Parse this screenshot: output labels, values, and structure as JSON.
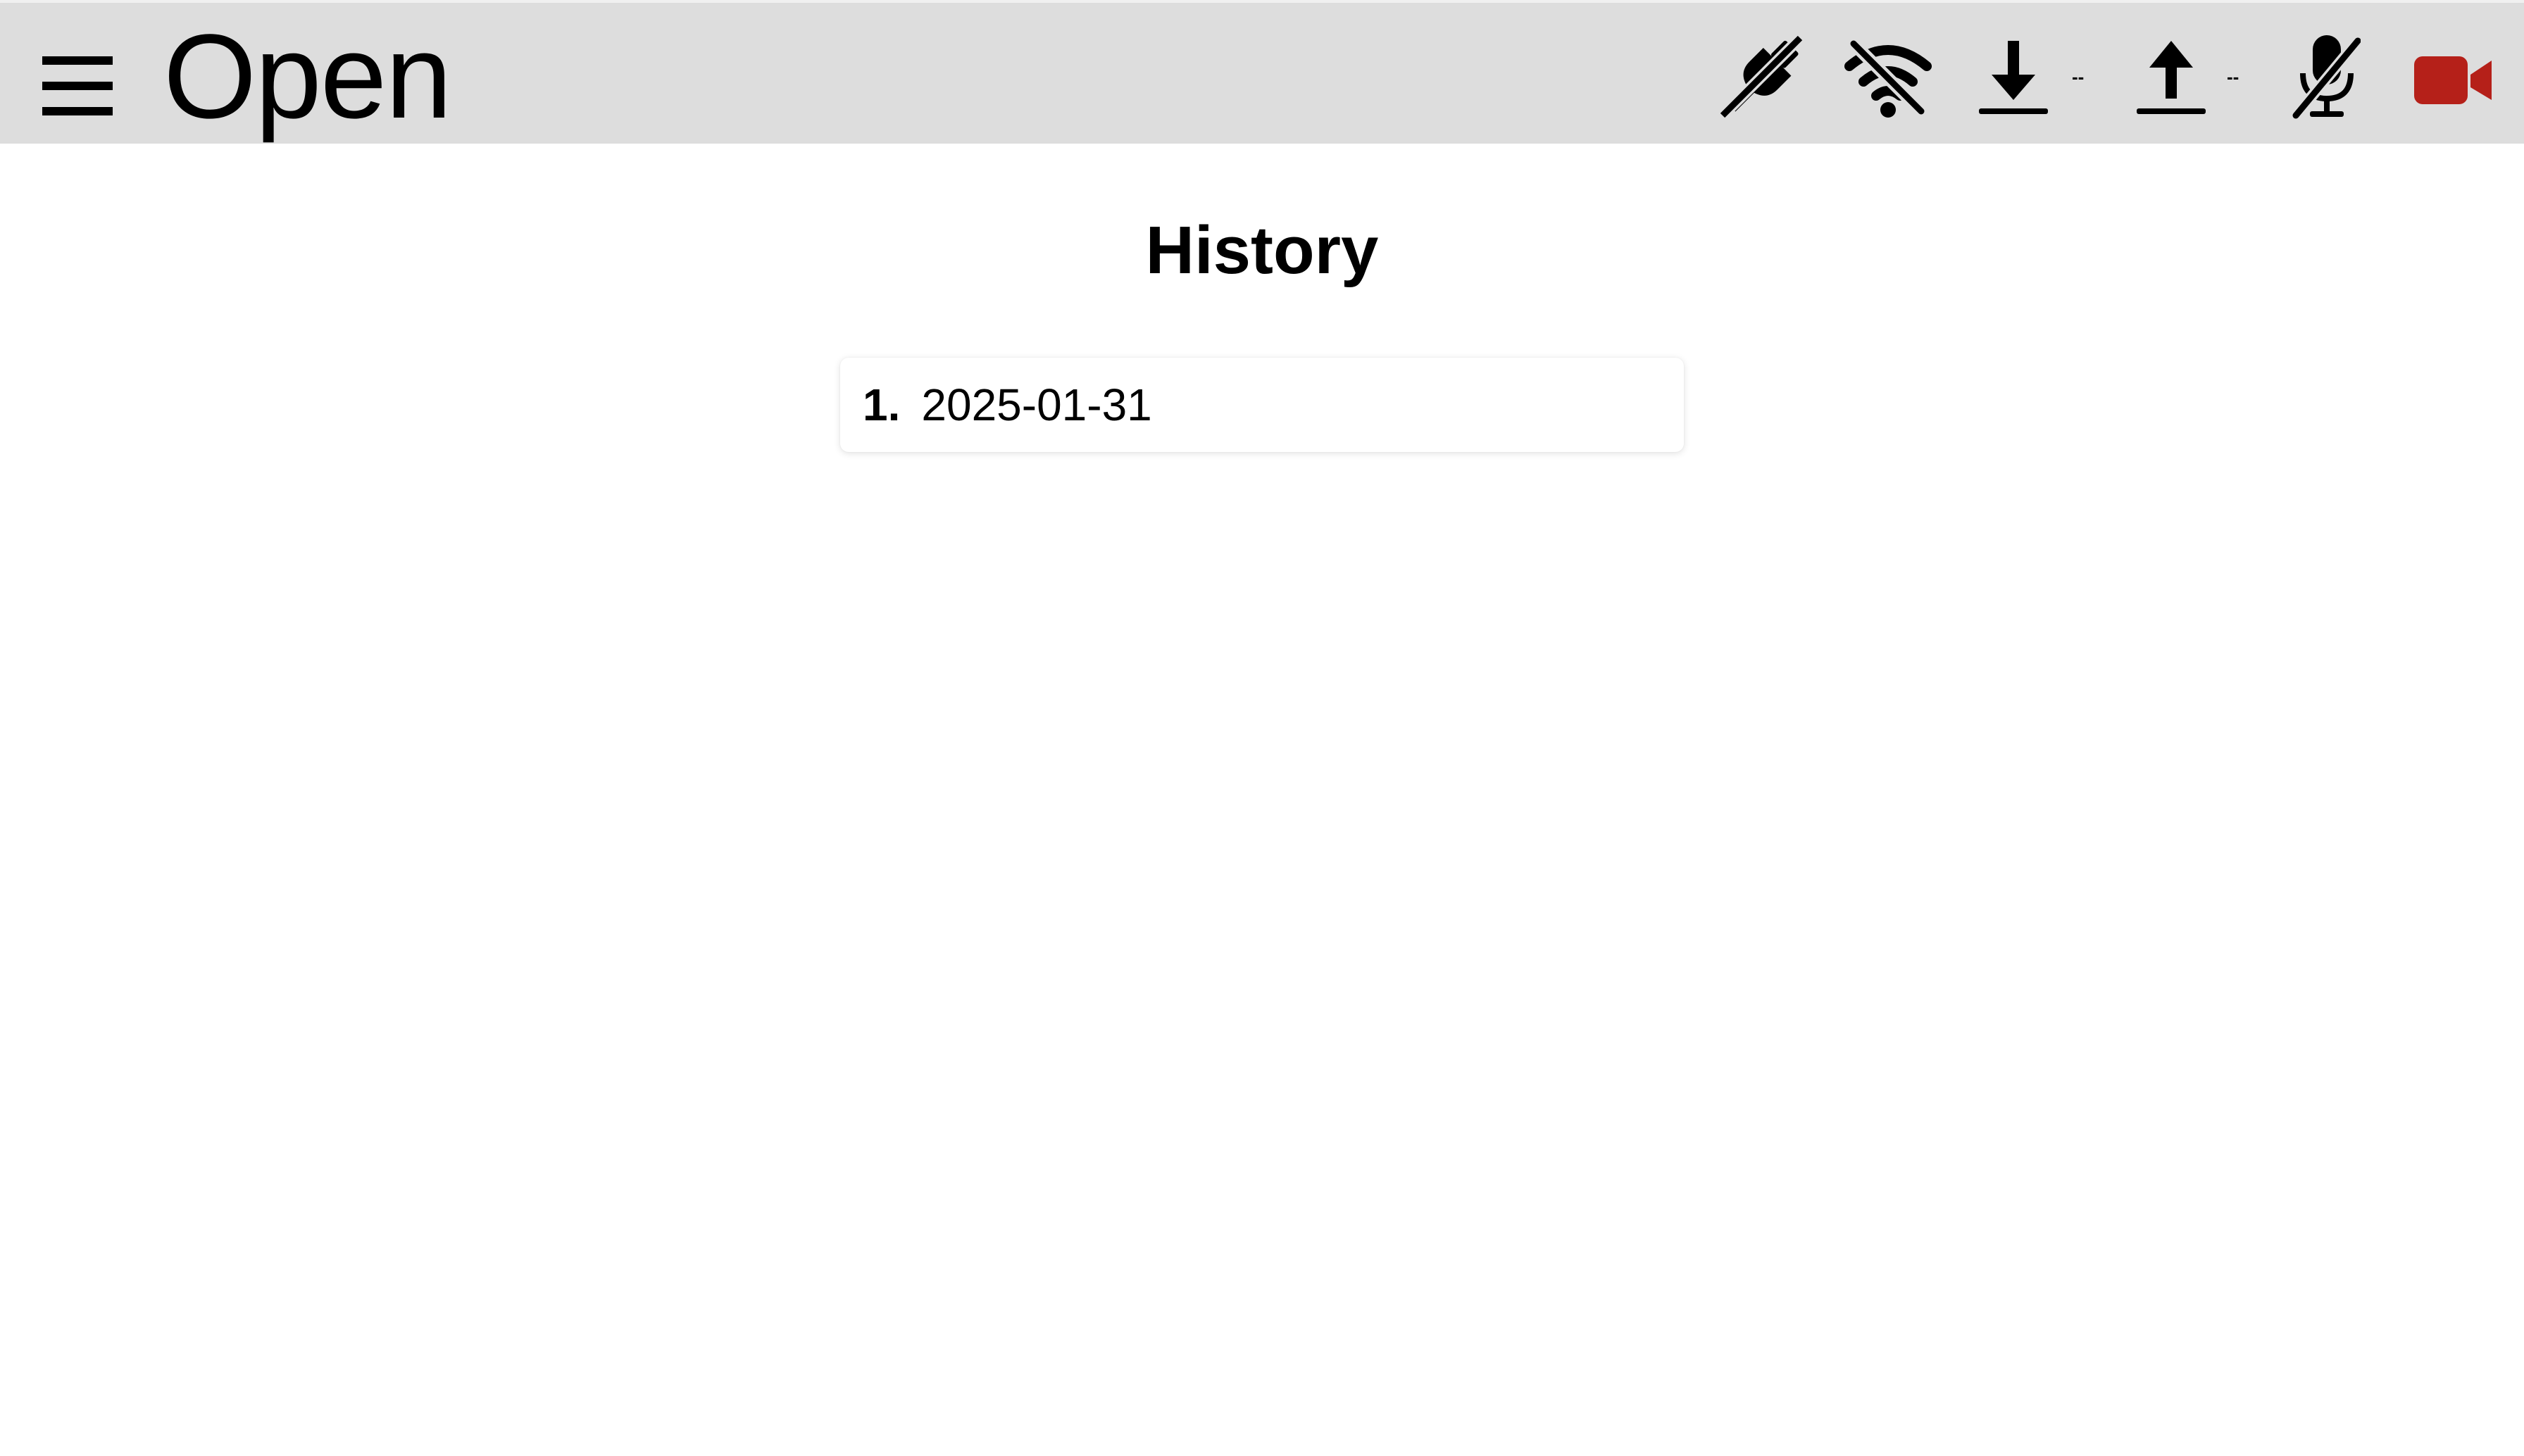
{
  "header": {
    "title": "Open",
    "menu_icon": "hamburger-menu-icon",
    "status": {
      "power_icon": "plug-disconnected-icon",
      "wifi_icon": "wifi-off-icon",
      "download_icon": "download-icon",
      "download_speed": "--",
      "upload_icon": "upload-icon",
      "upload_speed": "--",
      "mic_icon": "microphone-muted-icon",
      "camera_icon": "video-camera-icon",
      "camera_color": "#b52019"
    }
  },
  "main": {
    "heading": "History",
    "items": [
      {
        "index": "1.",
        "date": "2025-01-31"
      }
    ]
  }
}
